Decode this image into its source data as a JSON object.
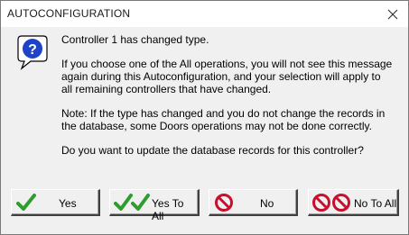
{
  "window": {
    "title": "AUTOCONFIGURATION",
    "close_icon": "close-x-icon"
  },
  "dialog": {
    "icon": "question-bubble-icon",
    "heading": "Controller 1 has changed type.",
    "paragraph1": "If you choose one of the All operations, you will not see this message\nagain during this Autoconfiguration, and your selection will apply to\nall remaining controllers that have changed.",
    "paragraph2": "Note:  If the type has changed and you do not change the records in\nthe database, some Doors operations may not be done correctly.",
    "question": "Do you want to update the database records for this controller?"
  },
  "buttons": {
    "yes": "Yes",
    "yes_to_all": "Yes To All",
    "no": "No",
    "no_to_all": "No To All"
  },
  "colors": {
    "check_green": "#2e9c2e",
    "no_red": "#c8102e"
  }
}
